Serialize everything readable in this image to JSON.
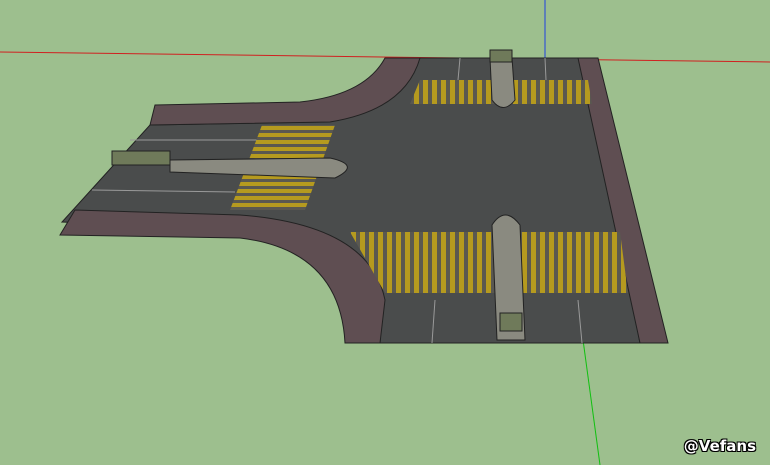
{
  "watermark": "@Vefans",
  "colors": {
    "background": "#9dbf8e",
    "asphalt": "#4a4c4c",
    "sidewalk": "#5f4e52",
    "crosswalk": "#b59a1f",
    "median": "#8a8a80",
    "axis_red": "#d02020",
    "axis_green": "#10c010",
    "axis_blue": "#2040e0"
  }
}
